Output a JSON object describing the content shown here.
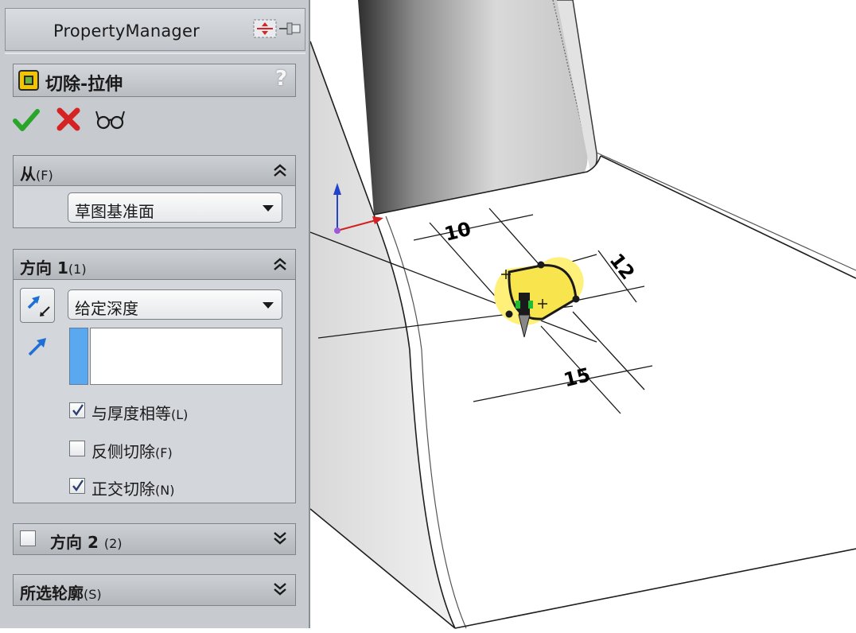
{
  "property_manager": {
    "title": "PropertyManager",
    "feature": {
      "title": "切除-拉伸",
      "help": "?"
    },
    "from": {
      "title": "从",
      "shortcut": "(F)",
      "value": "草图基准面"
    },
    "direction1": {
      "title": "方向 1",
      "shortcut": "(1)",
      "end_condition": "给定深度",
      "depth_value": "",
      "checkboxes": [
        {
          "label": "与厚度相等",
          "shortcut": "(L)",
          "checked": true
        },
        {
          "label": "反侧切除",
          "shortcut": "(F)",
          "checked": false
        },
        {
          "label": "正交切除",
          "shortcut": "(N)",
          "checked": true
        }
      ]
    },
    "direction2": {
      "title": "方向 2",
      "shortcut": "(2)",
      "checked": false
    },
    "selected_contours": {
      "title": "所选轮廓",
      "shortcut": "(S)"
    }
  },
  "viewport": {
    "dimensions": [
      "10",
      "12",
      "15"
    ]
  },
  "colors": {
    "accept": "#2aa52a",
    "cancel": "#d52222",
    "direction_arrow": "#1f6fd6",
    "depth_indicator": "#5aa8f0",
    "slot_fill": "#fff07a",
    "panel_bg": "#c7cbd0"
  },
  "icons": {
    "ok": "check-icon",
    "cancel": "x-icon",
    "preview": "glasses-icon",
    "reverse_direction": "reverse-direction-icon",
    "direction": "direction-arrow-icon",
    "pin": "pin-icon"
  }
}
